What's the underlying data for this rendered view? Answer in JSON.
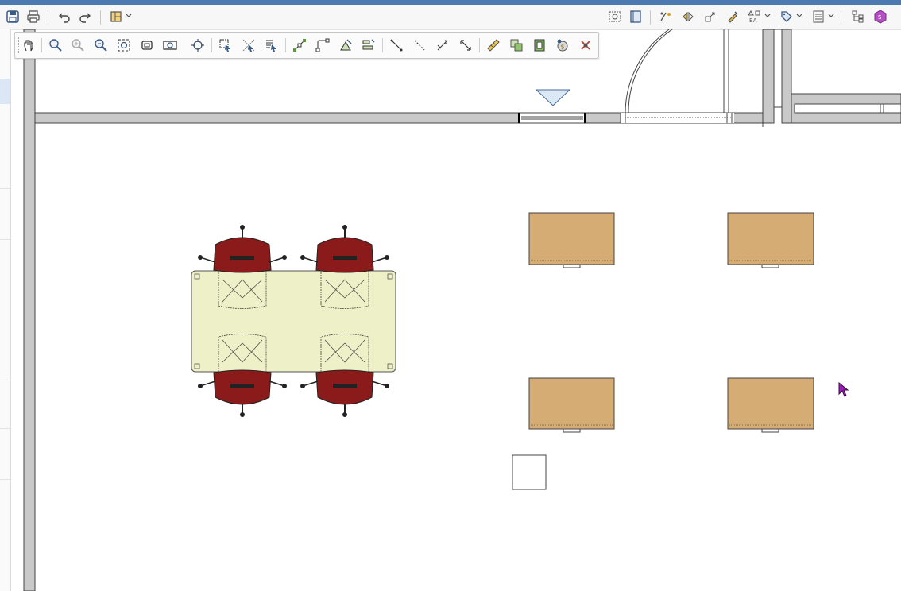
{
  "app": {
    "accent_color": "#4a7ab0"
  },
  "top_toolbar": {
    "left_icons": [
      "save-icon",
      "print-icon",
      "undo-icon",
      "redo-icon",
      "layout-icon"
    ],
    "right_icons": [
      "capture-view-icon",
      "book-icon",
      "transform-icon",
      "mirror-icon",
      "replicate-icon",
      "highlighter-icon",
      "symbols-icon",
      "tag-icon",
      "schedule-icon",
      "hierarchy-icon",
      "3d-object-icon"
    ]
  },
  "float_toolbar": {
    "icons": [
      "pan-icon",
      "zoom-icon",
      "zoom-in-icon",
      "zoom-out-icon",
      "fill-window-icon",
      "fit-icon",
      "view-all-icon",
      "center-icon",
      "select-icon",
      "select-rect-icon",
      "select-list-icon",
      "edit-points-icon",
      "edit-arc-icon",
      "edit-shape-icon",
      "align-icon",
      "line-icon",
      "dashed-line-icon",
      "dimension-icon",
      "arrow-dim-icon",
      "ruler-icon",
      "copy-icon",
      "film-icon",
      "coin-icon",
      "delete-icon"
    ]
  },
  "plan": {
    "wall_color": "#c9c9c9",
    "table_color": "#eef0c8",
    "chair_color": "#8b1a1a",
    "desk_color": "#d4ac74",
    "desks": 4,
    "chairs": 4
  }
}
